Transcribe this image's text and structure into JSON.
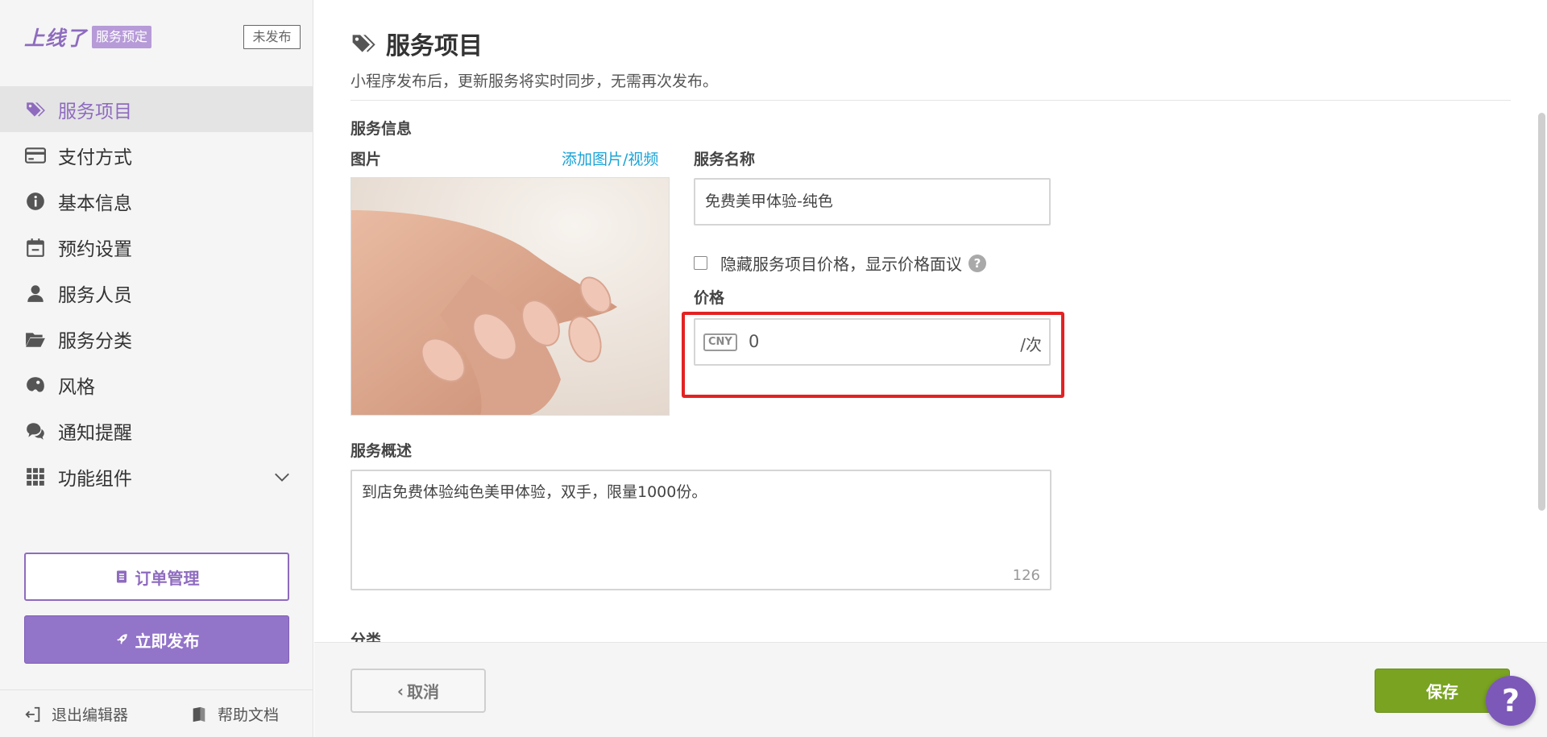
{
  "brand": {
    "logo": "上线了",
    "tag": "服务预定",
    "status": "未发布"
  },
  "sidebar": {
    "items": [
      {
        "label": "服务项目",
        "icon": "tags-icon",
        "active": true
      },
      {
        "label": "支付方式",
        "icon": "credit-card-icon"
      },
      {
        "label": "基本信息",
        "icon": "info-icon"
      },
      {
        "label": "预约设置",
        "icon": "calendar-icon"
      },
      {
        "label": "服务人员",
        "icon": "user-icon"
      },
      {
        "label": "服务分类",
        "icon": "folder-open-icon"
      },
      {
        "label": "风格",
        "icon": "palette-icon"
      },
      {
        "label": "通知提醒",
        "icon": "chat-icon"
      },
      {
        "label": "功能组件",
        "icon": "grid-icon",
        "expandable": true
      }
    ],
    "orders_button": "订单管理",
    "publish_button": "立即发布",
    "exit_link": "退出编辑器",
    "help_link": "帮助文档"
  },
  "page": {
    "title": "服务项目",
    "subtitle": "小程序发布后，更新服务将实时同步，无需再次发布。"
  },
  "form": {
    "section_title": "服务信息",
    "image_label": "图片",
    "add_media_link": "添加图片/视频",
    "name_label": "服务名称",
    "name_value": "免费美甲体验-纯色",
    "hide_price_label": "隐藏服务项目价格，显示价格面议",
    "hide_price_help": "?",
    "price_label": "价格",
    "currency": "CNY",
    "price_value": "0",
    "price_unit": "/次",
    "description_label": "服务概述",
    "description_value": "到店免费体验纯色美甲体验，双手，限量1000份。",
    "description_count": "126",
    "category_label": "分类"
  },
  "actions": {
    "cancel": "取消",
    "save": "保存",
    "help_fab": "?"
  },
  "colors": {
    "accent": "#8e6bbf",
    "save": "#79a321",
    "link": "#1aa3d6",
    "highlight": "#e32222"
  }
}
